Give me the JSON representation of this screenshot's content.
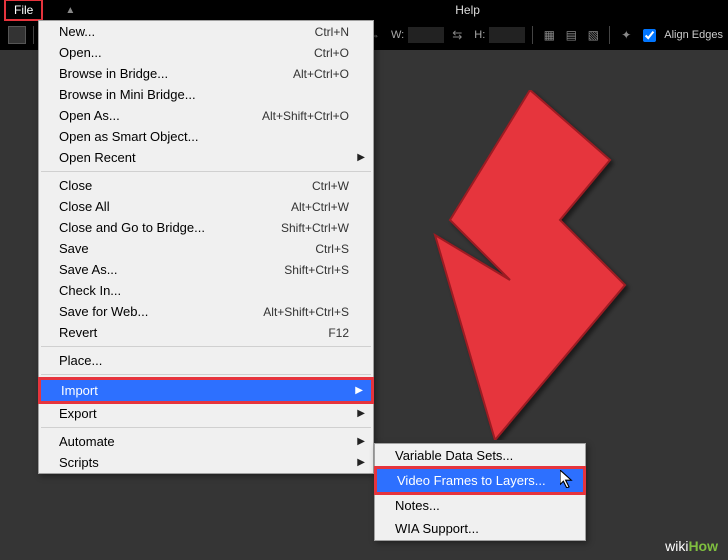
{
  "menubar": {
    "file": "File",
    "help": "Help"
  },
  "toolbar": {
    "w_label": "W:",
    "h_label": "H:",
    "align_edges": "Align Edges"
  },
  "file_menu": {
    "items": [
      {
        "label": "New...",
        "shortcut": "Ctrl+N"
      },
      {
        "label": "Open...",
        "shortcut": "Ctrl+O"
      },
      {
        "label": "Browse in Bridge...",
        "shortcut": "Alt+Ctrl+O"
      },
      {
        "label": "Browse in Mini Bridge...",
        "shortcut": ""
      },
      {
        "label": "Open As...",
        "shortcut": "Alt+Shift+Ctrl+O"
      },
      {
        "label": "Open as Smart Object...",
        "shortcut": ""
      },
      {
        "label": "Open Recent",
        "shortcut": "",
        "submenu": true
      },
      {
        "sep": true
      },
      {
        "label": "Close",
        "shortcut": "Ctrl+W"
      },
      {
        "label": "Close All",
        "shortcut": "Alt+Ctrl+W"
      },
      {
        "label": "Close and Go to Bridge...",
        "shortcut": "Shift+Ctrl+W"
      },
      {
        "label": "Save",
        "shortcut": "Ctrl+S"
      },
      {
        "label": "Save As...",
        "shortcut": "Shift+Ctrl+S"
      },
      {
        "label": "Check In...",
        "shortcut": ""
      },
      {
        "label": "Save for Web...",
        "shortcut": "Alt+Shift+Ctrl+S"
      },
      {
        "label": "Revert",
        "shortcut": "F12"
      },
      {
        "sep": true
      },
      {
        "label": "Place...",
        "shortcut": ""
      },
      {
        "sep": true
      },
      {
        "label": "Import",
        "shortcut": "",
        "submenu": true,
        "highlight": true
      },
      {
        "label": "Export",
        "shortcut": "",
        "submenu": true
      },
      {
        "sep": true
      },
      {
        "label": "Automate",
        "shortcut": "",
        "submenu": true
      },
      {
        "label": "Scripts",
        "shortcut": "",
        "submenu": true
      }
    ]
  },
  "import_submenu": {
    "items": [
      {
        "label": "Variable Data Sets..."
      },
      {
        "label": "Video Frames to Layers...",
        "highlight": true
      },
      {
        "label": "Notes..."
      },
      {
        "label": "WIA Support..."
      }
    ]
  },
  "watermark": {
    "wiki": "wiki",
    "how": "How"
  },
  "colors": {
    "red": "#e6343d",
    "blue": "#2d70ff"
  }
}
